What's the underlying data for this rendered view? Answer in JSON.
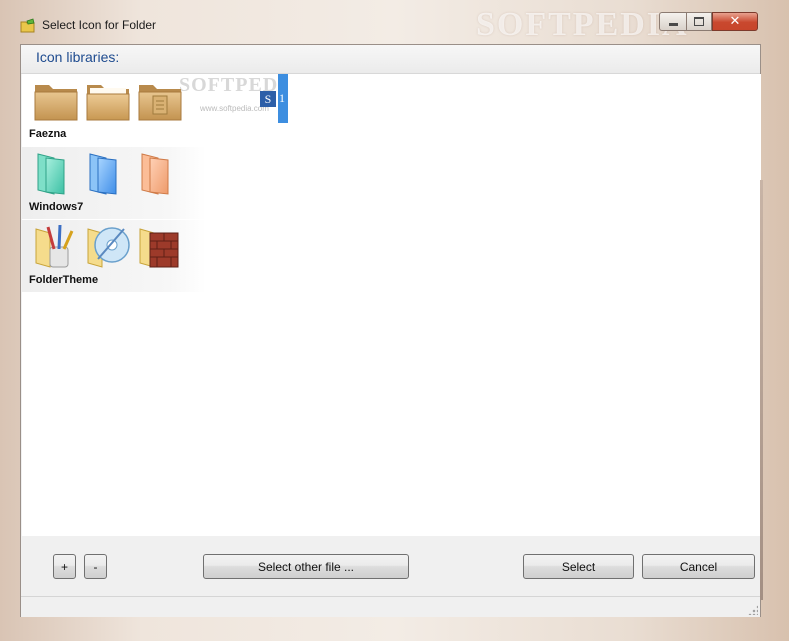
{
  "window": {
    "title": "Select Icon for Folder",
    "watermark": "SOFTPEDIA"
  },
  "content": {
    "header": "Icon libraries:",
    "watermark_small": "SOFTPEDI",
    "watermark_url": "www.softpedia.com",
    "selection_mark": "S",
    "selection_bar_text": "1",
    "libraries": [
      {
        "name": "Faezna",
        "icons": [
          "folder-icon",
          "folder-icon",
          "folder-document-icon"
        ]
      },
      {
        "name": "Windows7",
        "icons": [
          "teal-folder-icon",
          "blue-folder-icon",
          "orange-folder-icon"
        ]
      },
      {
        "name": "FolderTheme",
        "icons": [
          "brushes-folder-icon",
          "disc-folder-icon",
          "bricks-folder-icon"
        ]
      }
    ]
  },
  "buttons": {
    "add": "+",
    "remove": "-",
    "select_other": "Select other file ...",
    "select": "Select",
    "cancel": "Cancel"
  },
  "titlebar_buttons": {
    "close": "✕"
  }
}
